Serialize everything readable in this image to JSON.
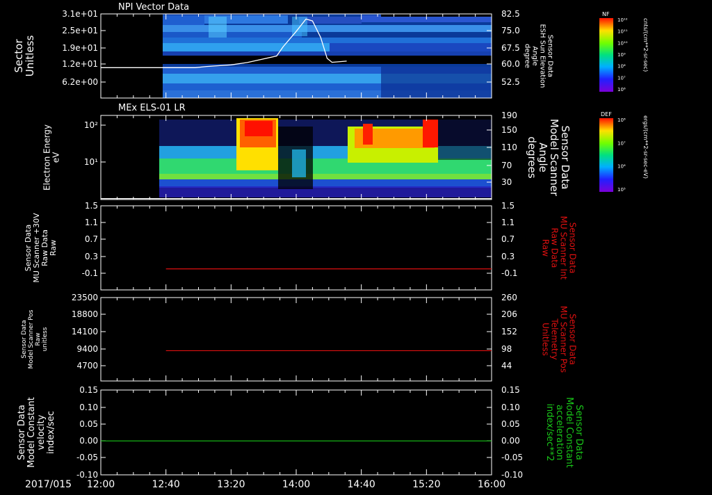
{
  "chart_data": [
    {
      "type": "heatmap",
      "title": "NPI Vector Data",
      "ylabel_lines": [
        "Sector",
        "Unitless"
      ],
      "yticks": [
        "3.1e+01",
        "2.5e+01",
        "1.9e+01",
        "1.2e+01",
        "6.2e+00"
      ],
      "y2label_lines": [
        "Sensor Data",
        "ESH Sun Elevation",
        "Angle",
        "degree"
      ],
      "y2ticks": [
        "82.5",
        "75.0",
        "67.5",
        "60.0",
        "52.5"
      ],
      "y2lim": [
        47,
        83
      ],
      "colorbar_title": "NF",
      "colorbar_ticks": [
        "10¹²",
        "10¹¹",
        "10¹⁰",
        "10⁹",
        "10⁸",
        "10⁷",
        "10⁶"
      ],
      "colorbar_units": "cnts/(cm**2-sr-sec)",
      "overlay_series": {
        "name": "ESH Sun Elevation Angle",
        "x_min": [
          0,
          40,
          58,
          65,
          80,
          90,
          108,
          112,
          120,
          126,
          130,
          135,
          139,
          142,
          151
        ],
        "y": [
          60.0,
          60.0,
          60.0,
          60.5,
          61.2,
          62.2,
          65.0,
          69.0,
          75.5,
          80.8,
          80.0,
          73.0,
          64.0,
          62.3,
          62.8
        ]
      }
    },
    {
      "type": "heatmap",
      "title": "MEx ELS-01 LR",
      "ylabel_lines": [
        "Electron Energy",
        "eV"
      ],
      "yticks": [
        "10²",
        "10¹"
      ],
      "y2label_lines": [
        "Sensor Data",
        "Model Scanner",
        "Angle",
        "degrees"
      ],
      "y2ticks": [
        "190",
        "150",
        "110",
        "70",
        "30"
      ],
      "y2lim": [
        10,
        190
      ],
      "colorbar_title": "DEF",
      "colorbar_ticks": [
        "10⁸",
        "10⁷",
        "10⁶",
        "10⁵"
      ],
      "colorbar_units": "ergs/(cm**2-sr-sec-eV)",
      "overlay_series": {
        "name": "Model Scanner Angle",
        "constant": 12
      }
    },
    {
      "type": "line",
      "ylabel_lines": [
        "Sensor Data",
        "MU Scanner +30V",
        "Raw Data",
        "Raw"
      ],
      "yticks": [
        "1.5",
        "1.1",
        "0.7",
        "0.3",
        "-0.1"
      ],
      "ylim": [
        -0.5,
        1.5
      ],
      "y2label_lines": [
        "Sensor Data",
        "MU Scanner Int",
        "Raw Data",
        "Raw"
      ],
      "y2ticks": [
        "1.5",
        "1.1",
        "0.7",
        "0.3",
        "-0.1"
      ],
      "series": [
        {
          "name": "MU Scanner Int",
          "x_start_min": 40,
          "value": 0.0,
          "color": "#e01010"
        }
      ]
    },
    {
      "type": "line",
      "ylabel_lines": [
        "Sensor Data",
        "Model Scanner Pos",
        "Raw",
        "unitless"
      ],
      "yticks": [
        "23500",
        "18800",
        "14100",
        "9400",
        "4700"
      ],
      "ylim": [
        0,
        23500
      ],
      "y2label_lines": [
        "Sensor Data",
        "MU Scanner Pos",
        "Telemetry",
        "Unitless"
      ],
      "y2ticks": [
        "260",
        "206",
        "152",
        "98",
        "44"
      ],
      "y2lim": [
        -10,
        260
      ],
      "series": [
        {
          "name": "MU Scanner Pos",
          "x_start_min": 40,
          "value": 88,
          "color": "#e01010"
        }
      ]
    },
    {
      "type": "line",
      "ylabel_lines": [
        "Sensor Data",
        "Model Constant",
        "velocity",
        "index/sec"
      ],
      "yticks": [
        "0.15",
        "0.10",
        "0.05",
        "0.00",
        "-0.05",
        "-0.10"
      ],
      "ylim": [
        -0.1,
        0.15
      ],
      "y2label_lines": [
        "Sensor Data",
        "Model Constant",
        "acceleration",
        "index/sec**2"
      ],
      "y2ticks": [
        "0.15",
        "0.10",
        "0.05",
        "0.00",
        "-0.05",
        "-0.10"
      ],
      "series": [
        {
          "name": "Model Constant acceleration",
          "x_start_min": 0,
          "value": 0.0,
          "color": "#19c819"
        }
      ]
    }
  ],
  "x_axis": {
    "date": "2017/015",
    "tick_labels": [
      "12:00",
      "12:40",
      "13:20",
      "14:00",
      "14:40",
      "15:20",
      "16:00"
    ],
    "range_min": [
      0,
      240
    ]
  },
  "colors": {
    "background": "#000000",
    "text": "#ffffff",
    "red_label": "#e01010",
    "green_label": "#19c819"
  }
}
